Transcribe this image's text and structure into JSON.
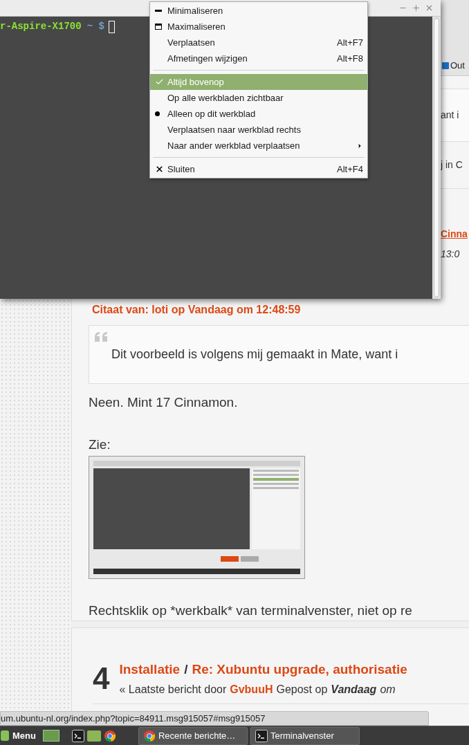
{
  "terminal": {
    "prompt_user": "r-Aspire-X1700",
    "prompt_path": "~ $"
  },
  "context_menu": {
    "items": [
      {
        "kind": "minimize",
        "label": "Minimaliseren",
        "highlighted": false
      },
      {
        "kind": "maximize",
        "label": "Maximaliseren",
        "highlighted": false
      },
      {
        "kind": "plain",
        "label": "Verplaatsen",
        "shortcut": "Alt+F7",
        "highlighted": false
      },
      {
        "kind": "plain",
        "label": "Afmetingen wijzigen",
        "shortcut": "Alt+F8",
        "highlighted": false
      },
      {
        "kind": "separator"
      },
      {
        "kind": "check",
        "label": "Altijd bovenop",
        "checked": true,
        "highlighted": true
      },
      {
        "kind": "radio",
        "label": "Op alle werkbladen zichtbaar",
        "checked": false,
        "highlighted": false
      },
      {
        "kind": "radio",
        "label": "Alleen op dit werkblad",
        "checked": true,
        "highlighted": false
      },
      {
        "kind": "plain",
        "label": "Verplaatsen naar werkblad rechts",
        "highlighted": false
      },
      {
        "kind": "submenu",
        "label": "Naar ander werkblad verplaatsen",
        "highlighted": false
      },
      {
        "kind": "separator"
      },
      {
        "kind": "close",
        "label": "Sluiten",
        "shortcut": "Alt+F4",
        "highlighted": false
      }
    ]
  },
  "browser_edge": {
    "bookmark": "Out",
    "quote_fragment": "ant i",
    "text_fragment": "j in C",
    "link_fragment": "Cinna",
    "time_fragment": "13:0"
  },
  "post": {
    "quote_header": "Citaat van: loti op Vandaag om 12:48:59",
    "quote_text": "Dit voorbeeld is volgens mij gemaakt in Mate, want i",
    "paragraphs": [
      "Neen. Mint 17 Cinnamon.",
      "Zie:"
    ],
    "closing": "Rechtsklik op *werkbalk* van terminalvenster, niet op re"
  },
  "topic": {
    "number": "4",
    "board": "Installatie",
    "separator": "/",
    "subject": "Re: Xubuntu upgrade, authorisatie",
    "prefix": "« Laatste bericht door",
    "author": "GvbuuH",
    "posted": "Gepost op",
    "date": "Vandaag",
    "time": "om"
  },
  "status_url": "um.ubuntu-nl.org/index.php?topic=84911.msg915057#msg915057",
  "taskbar": {
    "menu_label": "Menu",
    "windows": [
      {
        "kind": "browser",
        "label": "Recente berichte…"
      },
      {
        "kind": "terminal",
        "label": "Terminalvenster"
      }
    ]
  }
}
